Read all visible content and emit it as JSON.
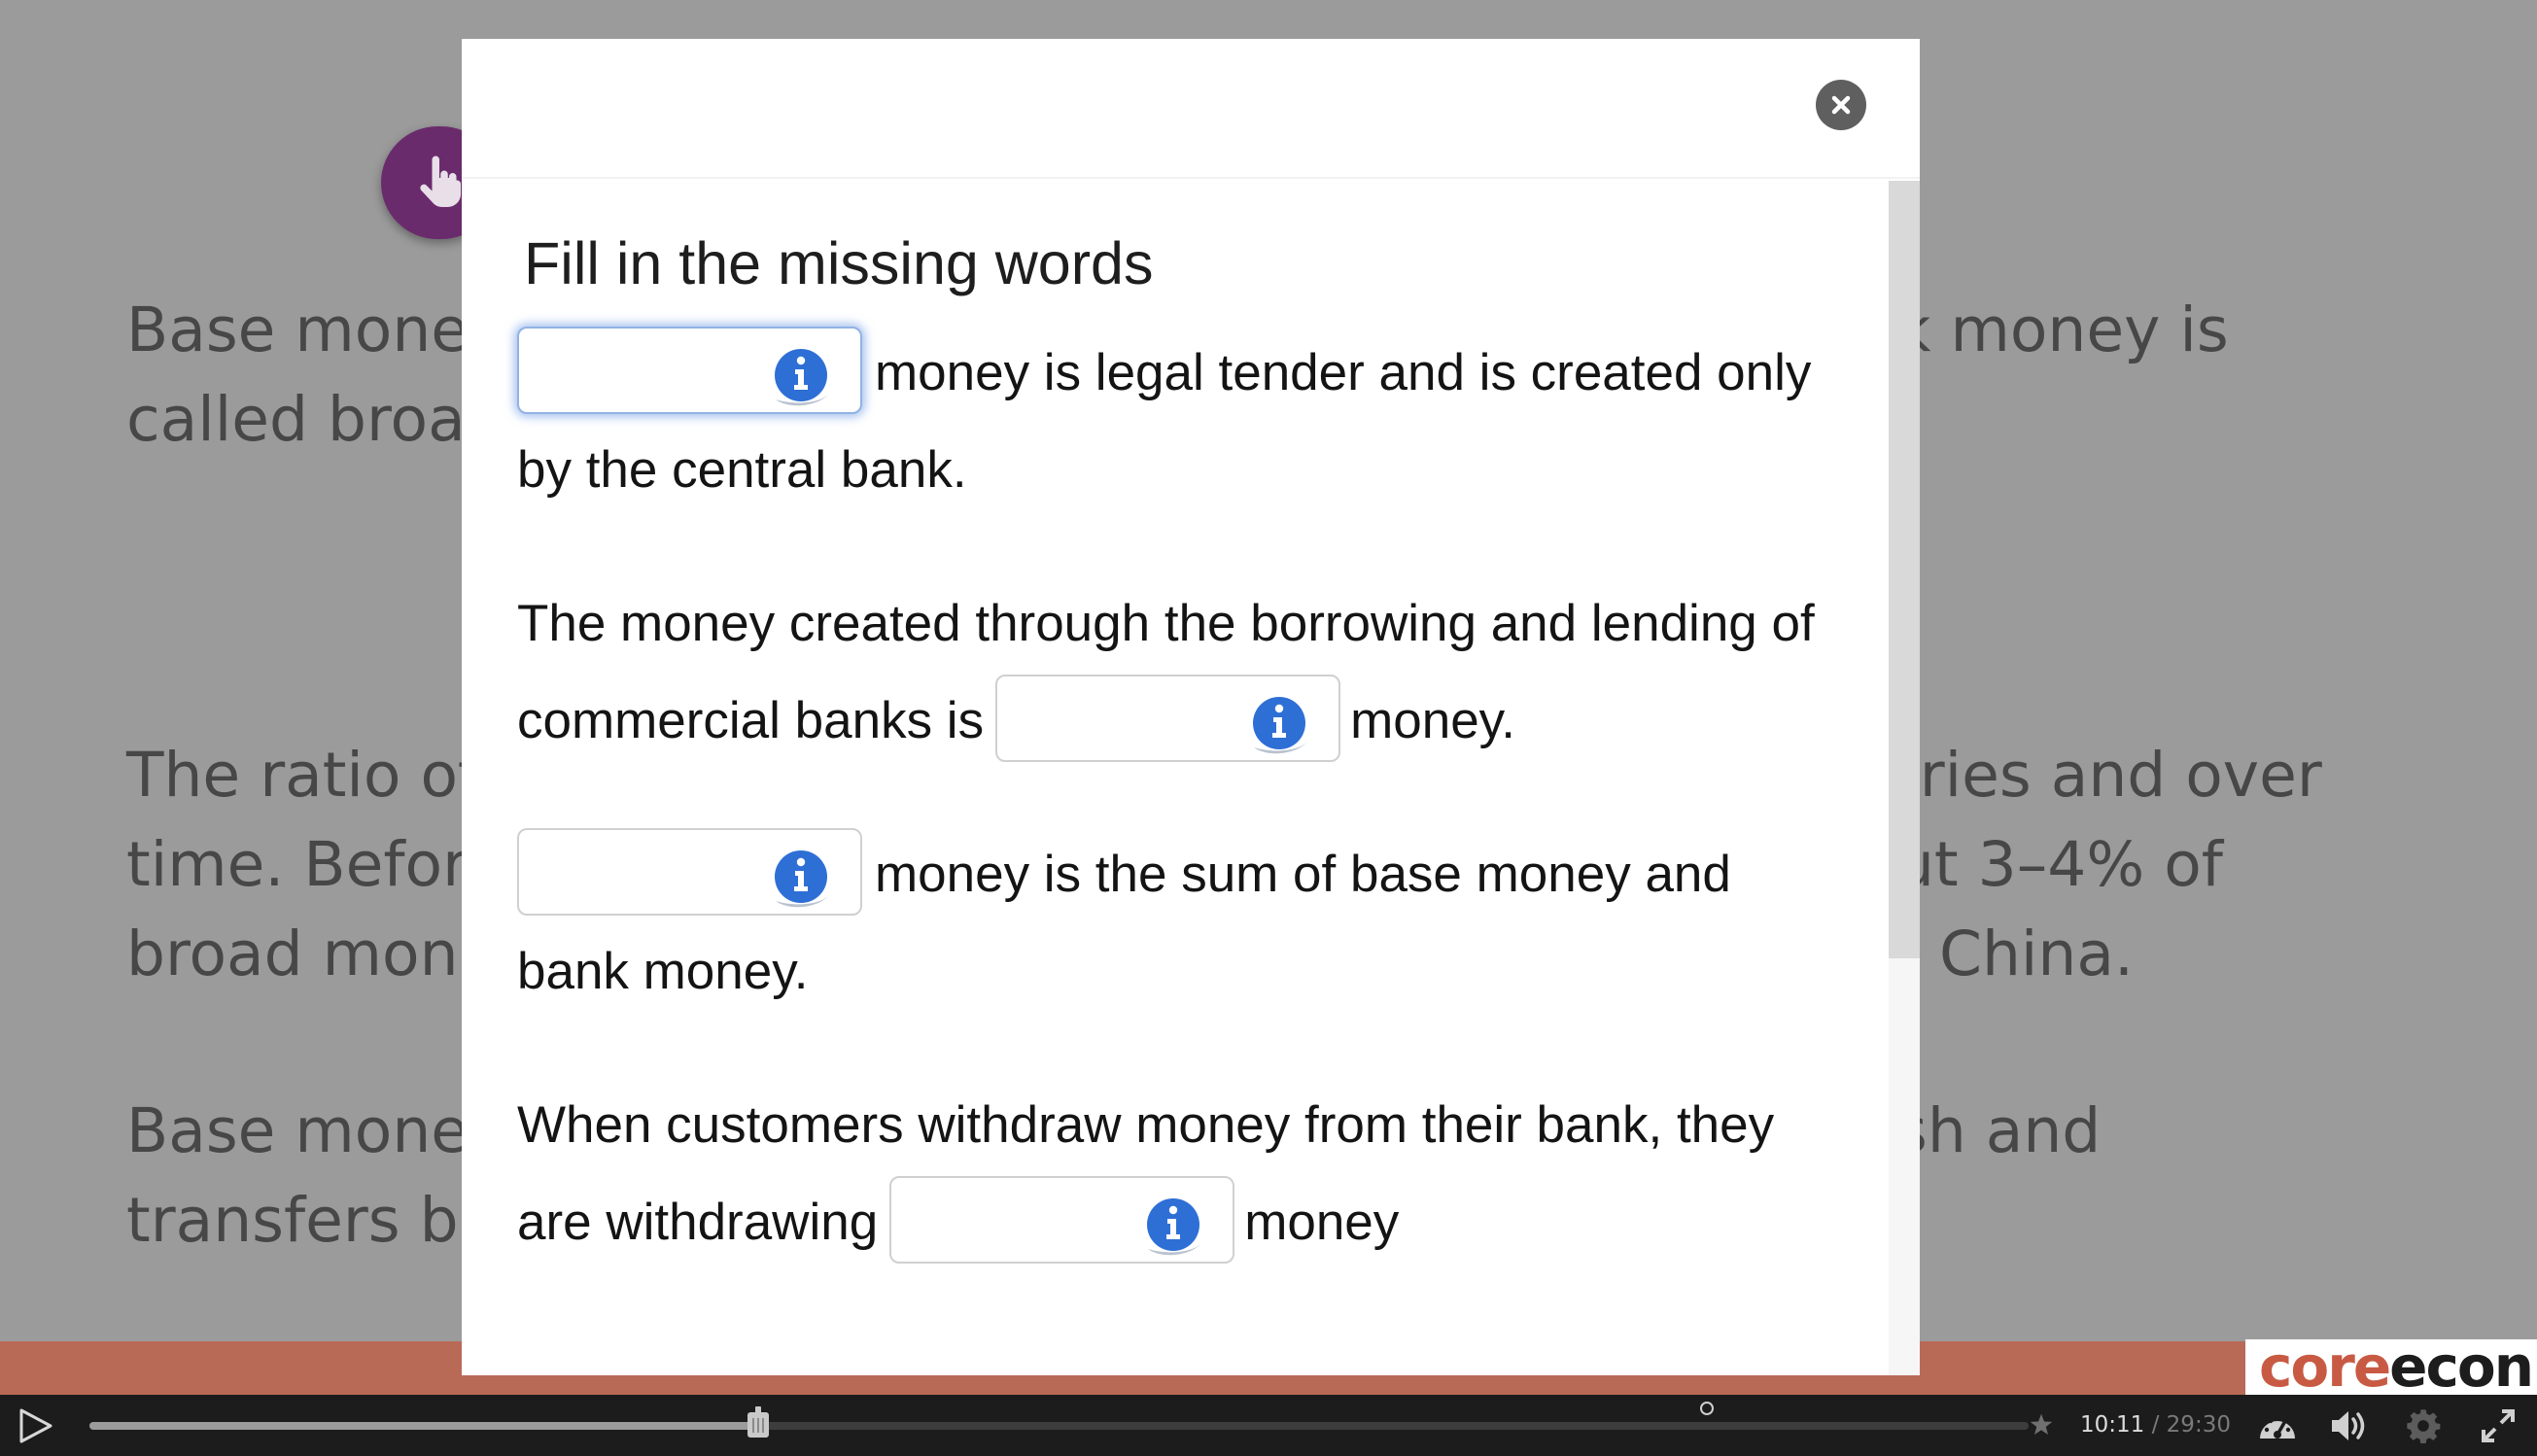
{
  "slide": {
    "col_left": [
      "Base mone",
      "called broa",
      "The ratio of",
      "time. Befor",
      "broad mon",
      "Base mone",
      "transfers be"
    ],
    "col_right": [
      "k money is",
      "tries and over",
      "ut 3–4% of",
      "China.",
      "sh and"
    ]
  },
  "branding": {
    "part1": "core",
    "part2": "econ"
  },
  "modal": {
    "title": "Fill in the missing words",
    "items": [
      {
        "after": "money is legal tender and is created only by the central bank.",
        "blank_value": ""
      },
      {
        "before": "The money created through the borrowing and lending of commercial banks is",
        "after": "money.",
        "blank_value": ""
      },
      {
        "after": "money is the sum of base money and bank money.",
        "blank_value": ""
      },
      {
        "before": "When customers withdraw money from their bank, they are withdrawing",
        "after": "money",
        "blank_value": ""
      }
    ]
  },
  "player": {
    "current_time": "10:11",
    "separator": "/",
    "duration": "29:30",
    "progress": 0.3448
  },
  "colors": {
    "accent_blue": "#2e6fd6",
    "hotspot_purple": "#6a2b6c",
    "brand_red": "#c85a43"
  },
  "icons": [
    "hand-pointer-icon",
    "close-icon",
    "info-icon",
    "play-icon",
    "scrub-handle-icon",
    "star-icon",
    "speedometer-icon",
    "volume-icon",
    "gear-icon",
    "fullscreen-icon"
  ]
}
